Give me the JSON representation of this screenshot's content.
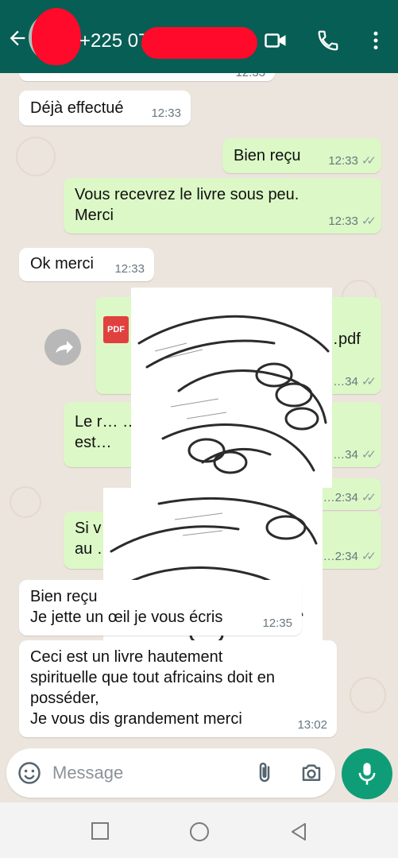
{
  "header": {
    "phone_number": "+225 07",
    "icons": [
      "back-arrow-icon",
      "video-call-icon",
      "voice-call-icon",
      "more-options-icon"
    ]
  },
  "messages": [
    {
      "side": "in",
      "text": "Déjà effectué",
      "time": "12:33"
    },
    {
      "side": "out",
      "text": "Bien reçu",
      "time": "12:33",
      "status": "✓✓"
    },
    {
      "side": "out",
      "text": "Vous recevrez le livre sous peu.\nMerci",
      "time": "12:33",
      "status": "✓✓"
    },
    {
      "side": "in",
      "text": "Ok merci",
      "time": "12:33"
    },
    {
      "side": "out",
      "text": "…pdf",
      "time": "…34",
      "status": "✓✓"
    },
    {
      "side": "out",
      "text": "Le r… …enu\nest…",
      "time": "…34",
      "status": "✓✓"
    },
    {
      "side": "out",
      "text": "",
      "time": "…2:34",
      "status": "✓✓"
    },
    {
      "side": "out",
      "text": "Si v… …éder\nau …",
      "time": "…2:34",
      "status": "✓✓"
    },
    {
      "side": "in",
      "text": "Bien reçu\nJe jette un œil je vous écris",
      "time": "12:35"
    },
    {
      "side": "in",
      "text": "Ceci est un livre hautement\nspirituelle que tout africains doit en\nposséder,\nJe vous dis grandement merci",
      "time": "13:02"
    }
  ],
  "partial_top_time": "12:33",
  "pdf_label": "PDF",
  "composer": {
    "placeholder": "Message"
  },
  "colors": {
    "header": "#075e54",
    "outgoing": "#dcf8c6",
    "incoming": "#ffffff",
    "mic": "#0f9d78",
    "redaction": "#ff0a2a"
  }
}
